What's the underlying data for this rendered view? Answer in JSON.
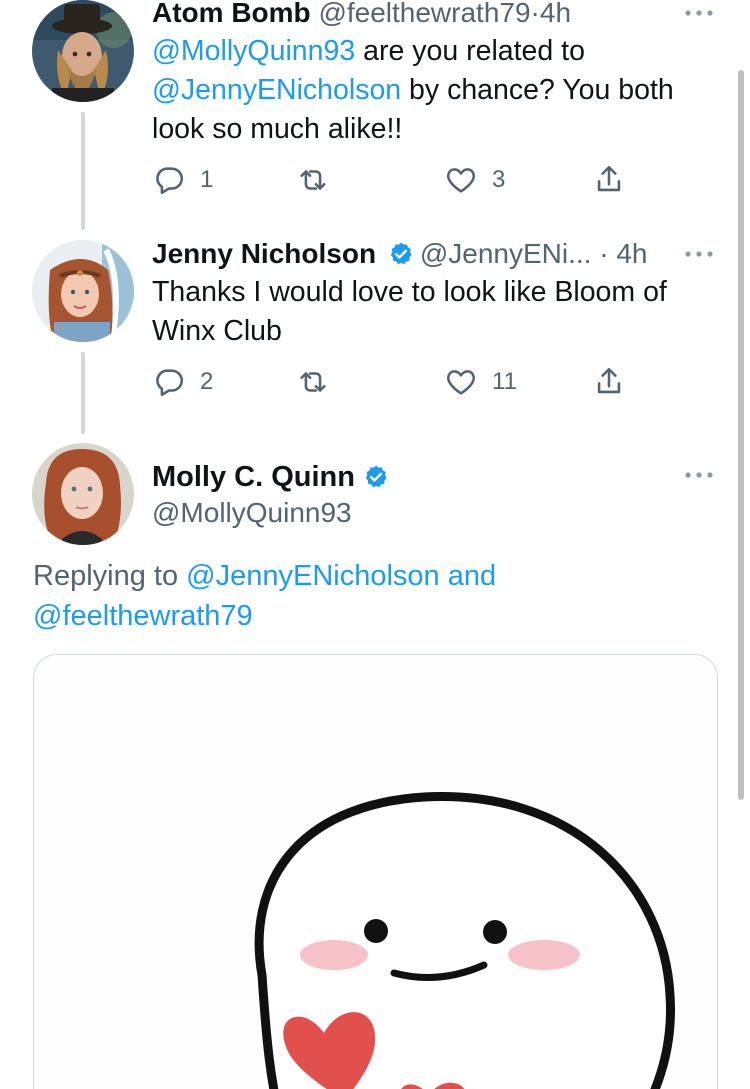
{
  "tweets": [
    {
      "name": "Atom Bomb",
      "handle": "@feelthewrath79",
      "time": "4h",
      "separator": "·",
      "text_parts": {
        "m1": "@MollyQuinn93",
        "t1": " are you related to ",
        "m2": "@JennyENicholson",
        "t2": " by chance? You both look so much alike!!"
      },
      "replies": "1",
      "likes": "3"
    },
    {
      "name": "Jenny Nicholson",
      "handle": "@JennyENi...",
      "time": "4h",
      "separator": "·",
      "text": "Thanks I would love to look like Bloom of Winx Club",
      "replies": "2",
      "likes": "11"
    }
  ],
  "main_tweet": {
    "name": "Molly C. Quinn",
    "handle": "@MollyQuinn93",
    "replying_prefix": "Replying to ",
    "replying_m1": "@JennyENicholson",
    "replying_and": " and",
    "replying_m2": "@feelthewrath79"
  },
  "icons": {
    "reply": "reply-icon",
    "retweet": "retweet-icon",
    "like": "heart-icon",
    "share": "share-icon",
    "more": "more-icon",
    "verified": "verified-badge-icon"
  },
  "colors": {
    "accent": "#1d9bf0",
    "secondary_text": "#536471",
    "primary_text": "#0f1419",
    "thread_line": "#cfd9de"
  }
}
